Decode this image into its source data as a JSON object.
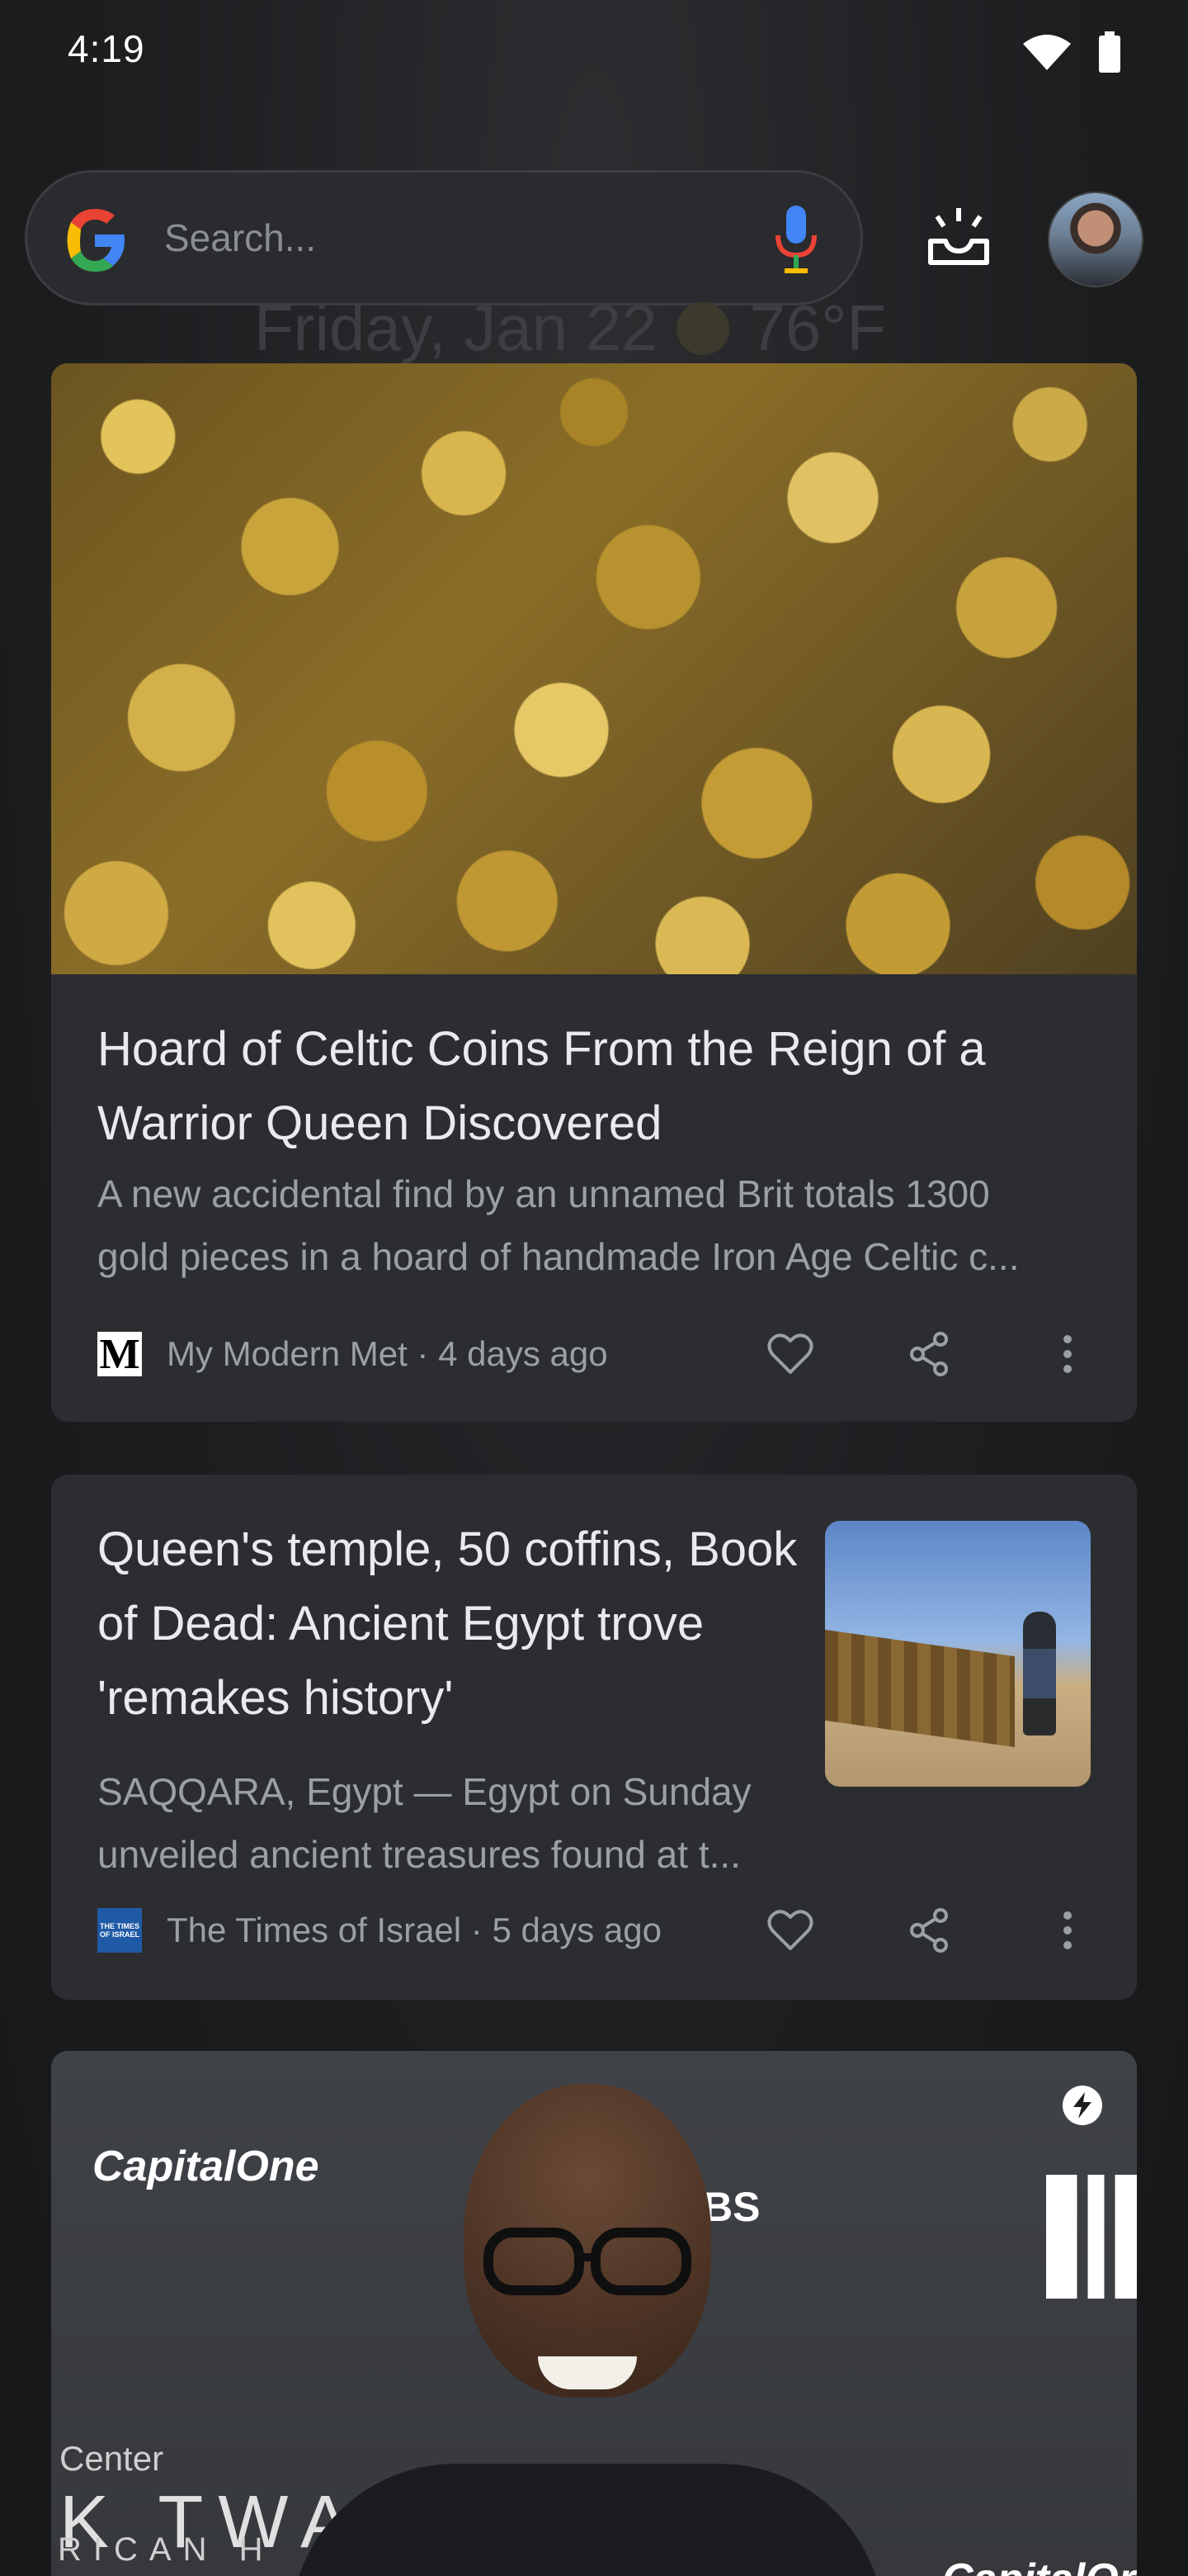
{
  "status_bar": {
    "time": "4:19"
  },
  "search": {
    "placeholder": "Search..."
  },
  "header": {
    "date": "Friday, Jan 22",
    "temperature": "76°F"
  },
  "cards": [
    {
      "title": "Hoard of Celtic Coins From the Reign of a Warrior Queen Discovered",
      "snippet_line1": "A new accidental find by an unnamed Brit totals 1300",
      "snippet_line2": "gold pieces in a hoard of handmade Iron Age Celtic c...",
      "source": "My Modern Met · 4 days ago",
      "source_logo": "M"
    },
    {
      "title": "Queen's temple, 50 coffins, Book of Dead: Ancient Egypt trove 'remakes history'",
      "snippet_line1": "SAQQARA, Egypt — Egypt on Sunday",
      "snippet_line2": "unveiled ancient treasures found at t...",
      "source": "The Times of Israel · 5 days ago",
      "source_logo": "THE TIMES OF ISRAEL"
    },
    {
      "image_text": {
        "brand_left": "CapitalOne",
        "brand_right": "CapitalOr",
        "pbs": "BS",
        "center": "Center",
        "twain": "K TWA",
        "rican": "RICAN  H"
      }
    }
  ],
  "icons": {
    "wifi": "wifi-icon",
    "battery": "battery-icon",
    "google": "google-g-icon",
    "mic": "mic-icon",
    "updates": "updates-icon",
    "like": "heart-icon",
    "share": "share-icon",
    "more": "more-vert-icon",
    "flash": "flash-icon"
  }
}
